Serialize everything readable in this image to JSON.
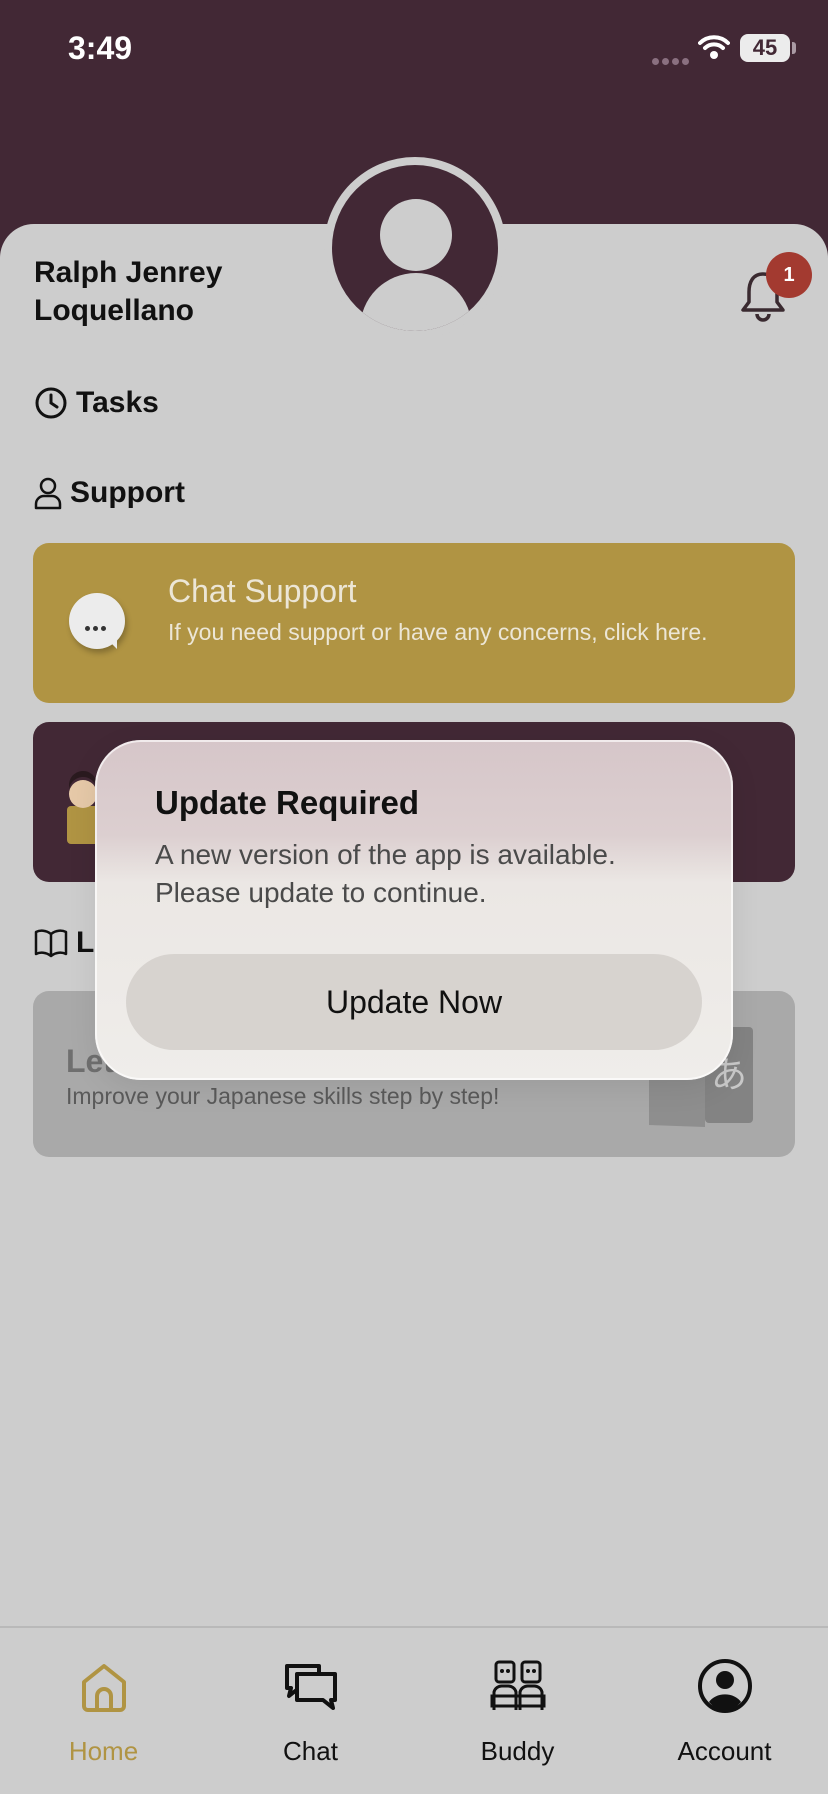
{
  "status_bar": {
    "time": "3:49",
    "battery": "45"
  },
  "profile": {
    "name": "Ralph Jenrey Loquellano",
    "notification_count": "1"
  },
  "sections": {
    "tasks": "Tasks",
    "support": "Support",
    "learning_partial": "Le"
  },
  "chat_support": {
    "title": "Chat Support",
    "description": "If you need support or have any concerns, click here."
  },
  "learn_card": {
    "title_partial": "Let",
    "description": "Improve your Japanese skills step by step!",
    "glyph": "あ"
  },
  "modal": {
    "title": "Update Required",
    "message": "A new version of the app is available. Please update to continue.",
    "button": "Update Now"
  },
  "tabs": [
    {
      "label": "Home",
      "icon": "home-icon",
      "active": true
    },
    {
      "label": "Chat",
      "icon": "chat-icon",
      "active": false
    },
    {
      "label": "Buddy",
      "icon": "buddy-icon",
      "active": false
    },
    {
      "label": "Account",
      "icon": "account-icon",
      "active": false
    }
  ],
  "colors": {
    "header": "#422835",
    "accent_gold": "#b09443",
    "badge_red": "#a33a30",
    "background": "#cdcdcd"
  }
}
